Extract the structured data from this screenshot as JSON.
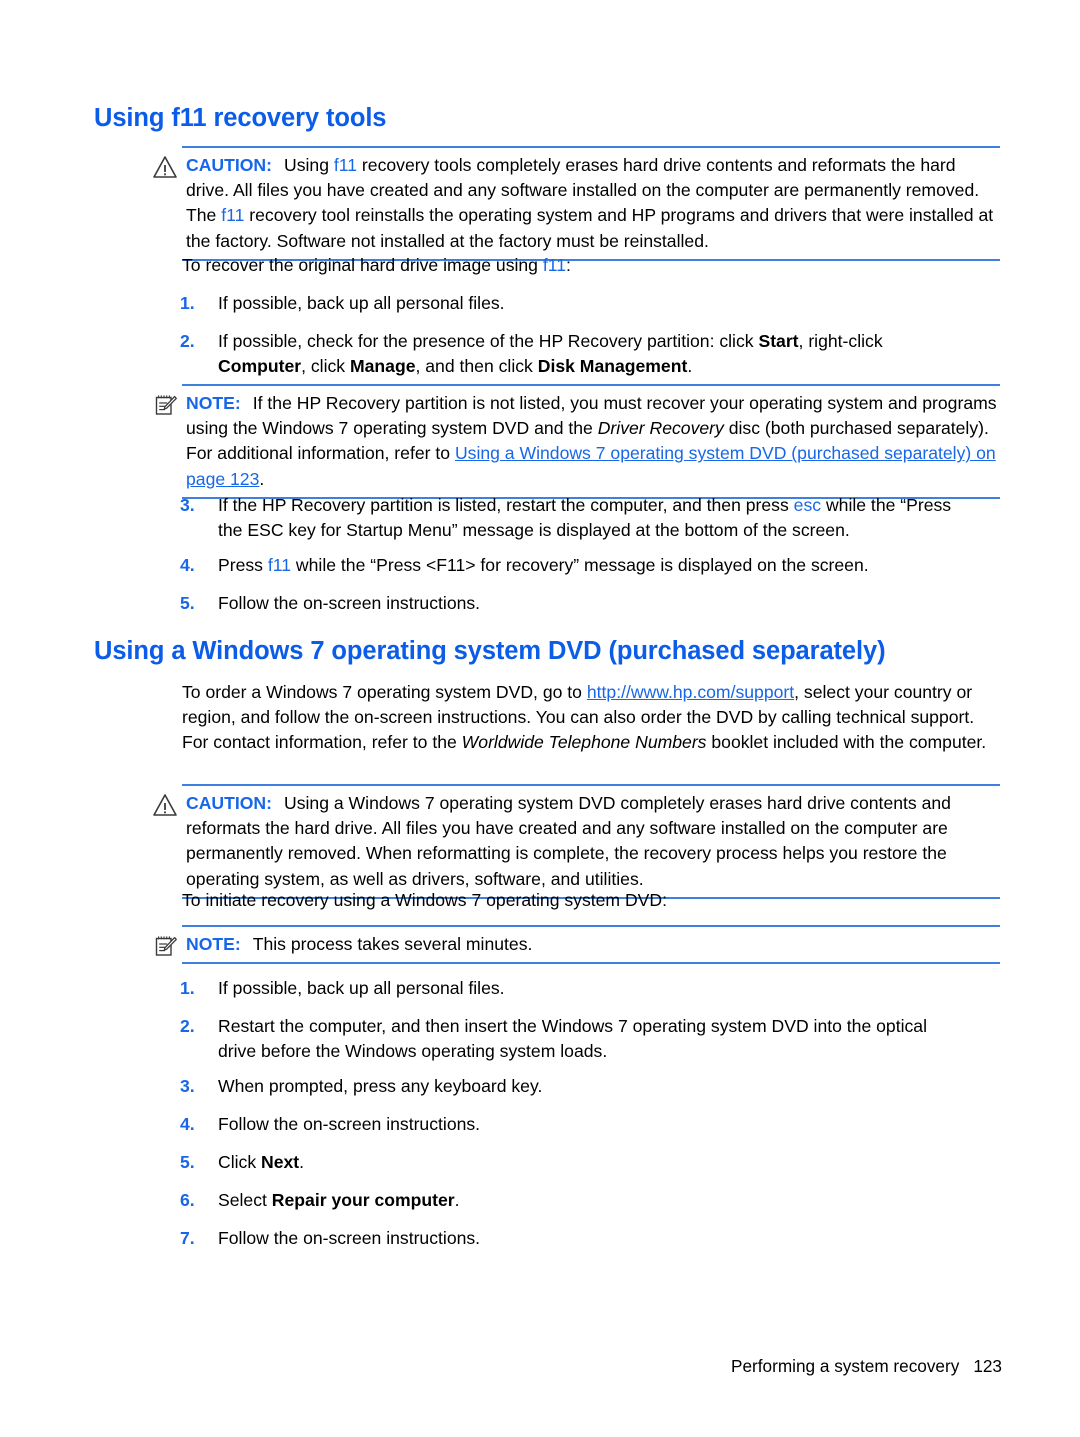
{
  "page": {
    "footer_text": "Performing a system recovery",
    "footer_page_number": "123",
    "accent_blue": "#0B5CE8",
    "link_blue": "#1767E8",
    "rule_blue": "#3E7FE0"
  },
  "section1": {
    "heading": "Using f11 recovery tools",
    "caution": {
      "label": "CAUTION:",
      "icon": "warning-triangle-icon",
      "text_a": "Using ",
      "keyword1": "f11",
      "text_b": " recovery tools completely erases hard drive contents and reformats the hard drive. All files you have created and any software installed on the computer are permanently removed. The ",
      "keyword2": "f11",
      "text_c": " recovery tool reinstalls the operating system and HP programs and drivers that were installed at the factory. Software not installed at the factory must be reinstalled."
    },
    "intro_a": "To recover the original hard drive image using ",
    "intro_keyword": "f11",
    "intro_b": ":",
    "steps": [
      {
        "num": "1.",
        "parts": [
          {
            "t": "If possible, back up all personal files.",
            "s": "plain"
          }
        ]
      },
      {
        "num": "2.",
        "parts": [
          {
            "t": "If possible, check for the presence of the HP Recovery partition: click ",
            "s": "plain"
          },
          {
            "t": "Start",
            "s": "bold"
          },
          {
            "t": ", right-click ",
            "s": "plain"
          },
          {
            "t": "Computer",
            "s": "bold"
          },
          {
            "t": ", click ",
            "s": "plain"
          },
          {
            "t": "Manage",
            "s": "bold"
          },
          {
            "t": ", and then click ",
            "s": "plain"
          },
          {
            "t": "Disk Management",
            "s": "bold"
          },
          {
            "t": ".",
            "s": "plain"
          }
        ]
      }
    ],
    "note": {
      "label": "NOTE:",
      "icon": "notepad-pencil-icon",
      "text_a": "If the HP Recovery partition is not listed, you must recover your operating system and programs using the Windows 7 operating system DVD and the ",
      "italic": "Driver Recovery",
      "text_b": " disc (both purchased separately). For additional information, refer to ",
      "link": "Using a Windows 7 operating system DVD (purchased separately) on page 123",
      "text_c": "."
    },
    "steps_after_note": [
      {
        "num": "3.",
        "parts": [
          {
            "t": "If the HP Recovery partition is listed, restart the computer, and then press ",
            "s": "plain"
          },
          {
            "t": "esc",
            "s": "blue"
          },
          {
            "t": " while the “Press the ESC key for Startup Menu” message is displayed at the bottom of the screen.",
            "s": "plain"
          }
        ]
      },
      {
        "num": "4.",
        "parts": [
          {
            "t": "Press ",
            "s": "plain"
          },
          {
            "t": "f11",
            "s": "blue"
          },
          {
            "t": " while the “Press <F11> for recovery” message is displayed on the screen.",
            "s": "plain"
          }
        ]
      },
      {
        "num": "5.",
        "parts": [
          {
            "t": "Follow the on-screen instructions.",
            "s": "plain"
          }
        ]
      }
    ]
  },
  "section2": {
    "heading": "Using a Windows 7 operating system DVD (purchased separately)",
    "paragraph": {
      "text_a": "To order a Windows 7 operating system DVD, go to ",
      "link": "http://www.hp.com/support",
      "text_b": ", select your country or region, and follow the on-screen instructions. You can also order the DVD by calling technical support. For contact information, refer to the ",
      "italic": "Worldwide Telephone Numbers",
      "text_c": " booklet included with the computer."
    },
    "caution": {
      "label": "CAUTION:",
      "icon": "warning-triangle-icon",
      "text": "Using a Windows 7 operating system DVD completely erases hard drive contents and reformats the hard drive. All files you have created and any software installed on the computer are permanently removed. When reformatting is complete, the recovery process helps you restore the operating system, as well as drivers, software, and utilities."
    },
    "intro": "To initiate recovery using a Windows 7 operating system DVD:",
    "note": {
      "label": "NOTE:",
      "icon": "notepad-pencil-icon",
      "text": "This process takes several minutes."
    },
    "steps": [
      {
        "num": "1.",
        "parts": [
          {
            "t": "If possible, back up all personal files.",
            "s": "plain"
          }
        ]
      },
      {
        "num": "2.",
        "parts": [
          {
            "t": "Restart the computer, and then insert the Windows 7 operating system DVD into the optical drive before the Windows operating system loads.",
            "s": "plain"
          }
        ]
      },
      {
        "num": "3.",
        "parts": [
          {
            "t": "When prompted, press any keyboard key.",
            "s": "plain"
          }
        ]
      },
      {
        "num": "4.",
        "parts": [
          {
            "t": "Follow the on-screen instructions.",
            "s": "plain"
          }
        ]
      },
      {
        "num": "5.",
        "parts": [
          {
            "t": "Click ",
            "s": "plain"
          },
          {
            "t": "Next",
            "s": "bold"
          },
          {
            "t": ".",
            "s": "plain"
          }
        ]
      },
      {
        "num": "6.",
        "parts": [
          {
            "t": "Select ",
            "s": "plain"
          },
          {
            "t": "Repair your computer",
            "s": "bold"
          },
          {
            "t": ".",
            "s": "plain"
          }
        ]
      },
      {
        "num": "7.",
        "parts": [
          {
            "t": "Follow the on-screen instructions.",
            "s": "plain"
          }
        ]
      }
    ]
  }
}
